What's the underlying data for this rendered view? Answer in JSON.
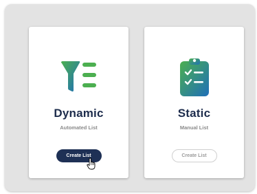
{
  "cards": {
    "dynamic": {
      "title": "Dynamic",
      "subtitle": "Automated List",
      "button_label": "Create List",
      "icon": "funnel-list-icon"
    },
    "static": {
      "title": "Static",
      "subtitle": "Manual List",
      "button_label": "Create List",
      "icon": "clipboard-checklist-icon"
    }
  },
  "colors": {
    "title": "#1d2c4c",
    "primary_button": "#1e3055",
    "gradient_green": "#4caf50",
    "gradient_blue": "#1f6fb8",
    "panel_background": "#e3e3e3"
  }
}
